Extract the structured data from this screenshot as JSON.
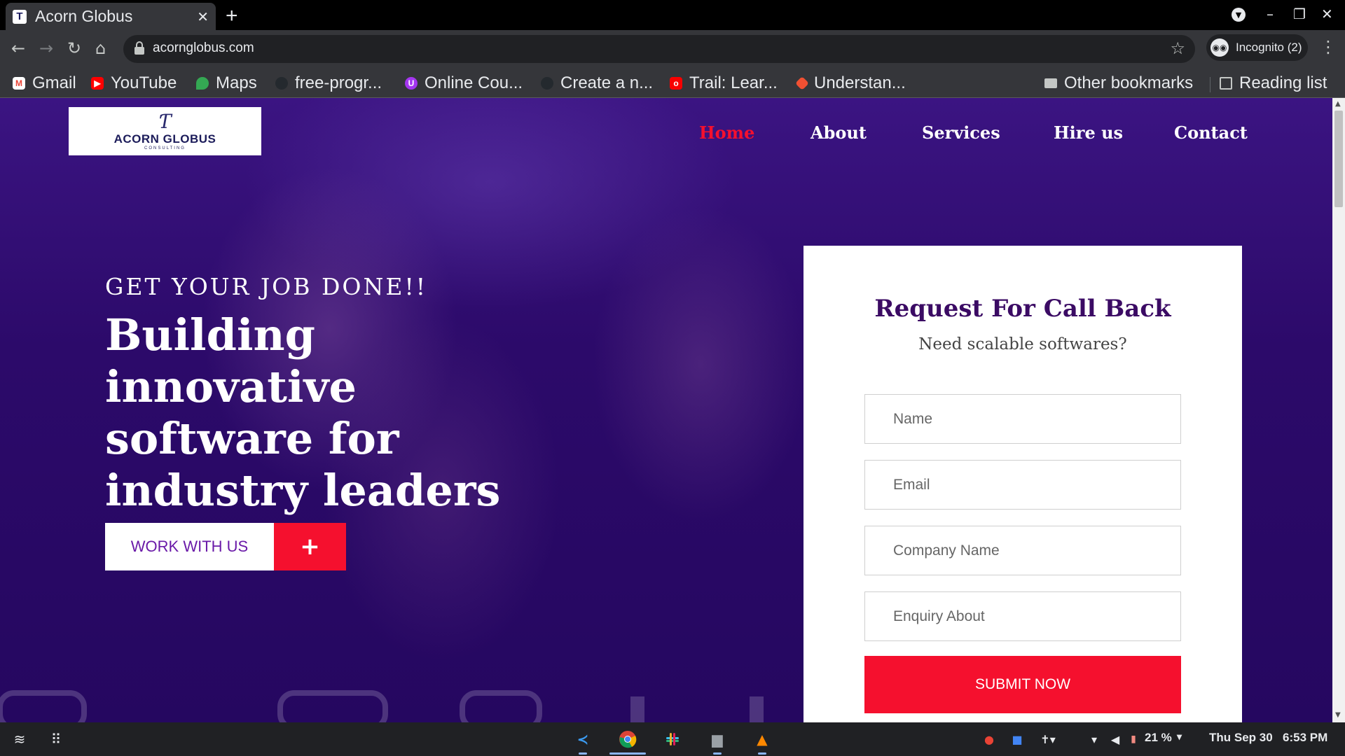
{
  "browser": {
    "tab_title": "Acorn Globus",
    "url": "acornglobus.com",
    "incognito_label": "Incognito (2)",
    "bookmarks": [
      {
        "label": "Gmail",
        "icon": "gmail-icon",
        "color": "#ea4335"
      },
      {
        "label": "YouTube",
        "icon": "youtube-icon",
        "color": "#ff0000"
      },
      {
        "label": "Maps",
        "icon": "maps-icon",
        "color": "#34a853"
      },
      {
        "label": "free-progr...",
        "icon": "github-icon",
        "color": "#24292e"
      },
      {
        "label": "Online Cou...",
        "icon": "udemy-icon",
        "color": "#a435f0"
      },
      {
        "label": "Create a n...",
        "icon": "github-icon",
        "color": "#24292e"
      },
      {
        "label": "Trail: Lear...",
        "icon": "oracle-icon",
        "color": "#f80000"
      },
      {
        "label": "Understan...",
        "icon": "git-icon",
        "color": "#f05032"
      }
    ],
    "other_bookmarks": "Other bookmarks",
    "reading_list": "Reading list"
  },
  "site": {
    "logo": {
      "title": "ACORN GLOBUS",
      "subtitle": "CONSULTING"
    },
    "nav": [
      "Home",
      "About",
      "Services",
      "Hire us",
      "Contact"
    ],
    "active_nav": "Home",
    "hero": {
      "tagline": "GET YOUR JOB DONE!!",
      "headline": "Building innovative software for industry leaders",
      "cta_label": "WORK WITH US",
      "cta_icon": "+"
    },
    "form": {
      "title": "Request For Call Back",
      "subtitle": "Need scalable softwares?",
      "fields": [
        {
          "placeholder": "Name",
          "value": ""
        },
        {
          "placeholder": "Email",
          "value": ""
        },
        {
          "placeholder": "Company Name",
          "value": ""
        },
        {
          "placeholder": "Enquiry About",
          "value": ""
        }
      ],
      "submit_label": "SUBMIT NOW"
    },
    "colors": {
      "accent": "#f5102e",
      "brand_purple": "#3b0b64",
      "overlay": "#2c0a6a"
    }
  },
  "shelf": {
    "battery": "21 %",
    "date": "Thu Sep 30",
    "time": "6:53 PM",
    "apps": [
      "vscode-icon",
      "chrome-icon",
      "slack-icon",
      "files-icon",
      "vlc-icon"
    ]
  }
}
